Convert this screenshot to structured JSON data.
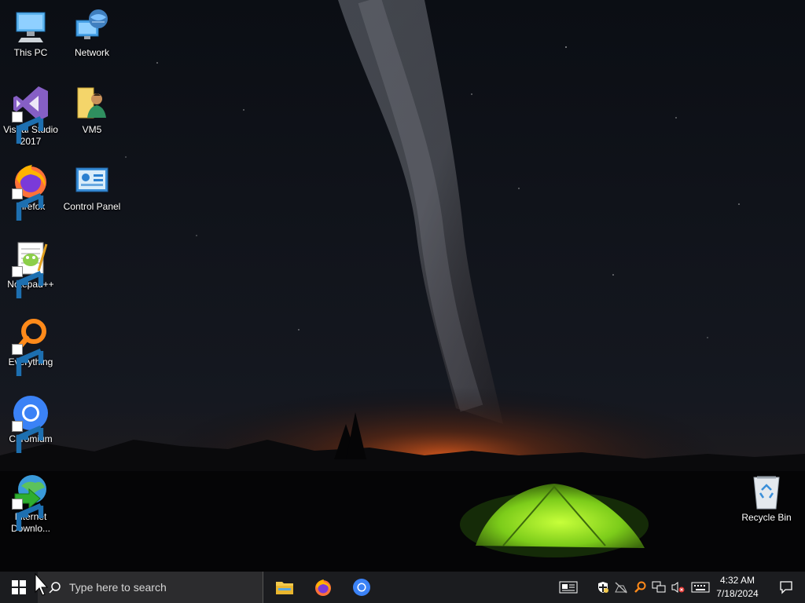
{
  "desktop": {
    "icons": [
      {
        "label": "This PC",
        "icon": "this-pc-icon"
      },
      {
        "label": "Network",
        "icon": "network-icon"
      },
      {
        "label": "Visual Studio 2017",
        "icon": "visual-studio-icon"
      },
      {
        "label": "VM5",
        "icon": "user-folder-icon"
      },
      {
        "label": "Firefox",
        "icon": "firefox-icon"
      },
      {
        "label": "Control Panel",
        "icon": "control-panel-icon"
      },
      {
        "label": "Notepad++",
        "icon": "notepadpp-icon"
      },
      {
        "label": "Everything",
        "icon": "everything-icon"
      },
      {
        "label": "Chromium",
        "icon": "chromium-icon"
      },
      {
        "label": "Internet Downlo...",
        "icon": "internet-download-manager-icon"
      },
      {
        "label": "Recycle Bin",
        "icon": "recycle-bin-icon"
      }
    ]
  },
  "taskbar": {
    "search_placeholder": "Type here to search",
    "pinned_apps": [
      "file-explorer-icon",
      "firefox-icon",
      "chromium-icon"
    ],
    "tray_icons": [
      "news-icon",
      "security-shield-icon",
      "network-off-icon",
      "search-tool-icon",
      "network-wired-icon",
      "volume-muted-icon",
      "keyboard-icon"
    ],
    "clock": {
      "time": "4:32 AM",
      "date": "7/18/2024"
    },
    "accent": "#1b1c1f"
  }
}
